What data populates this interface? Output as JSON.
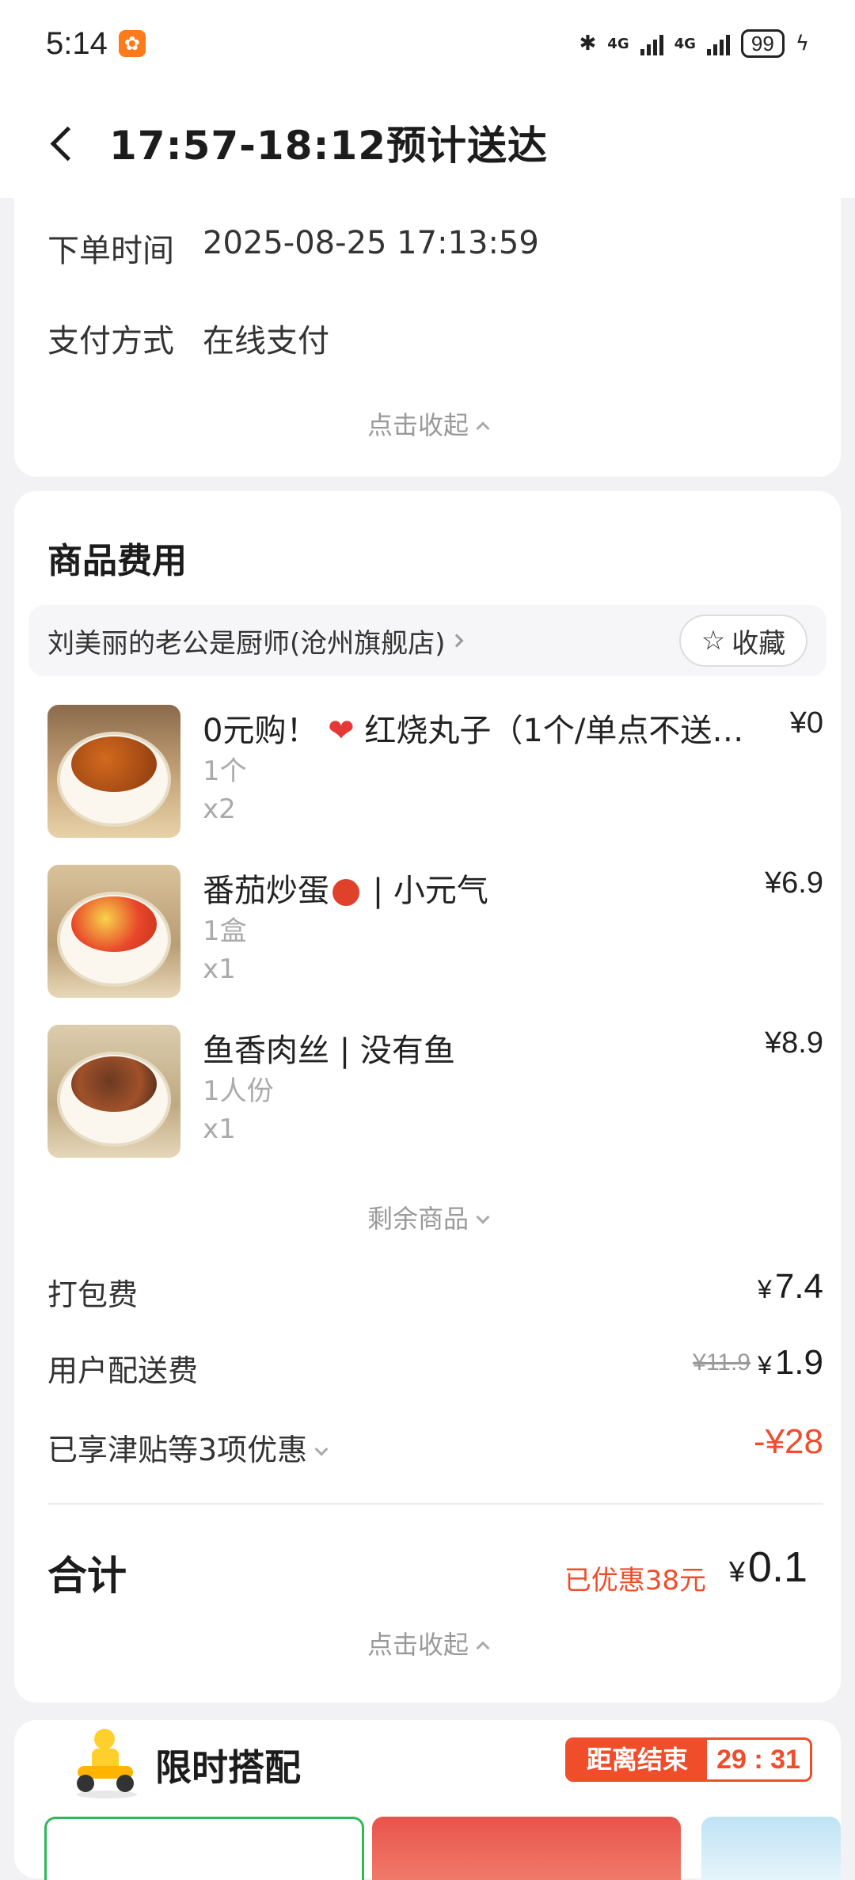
{
  "status_bar": {
    "time": "5:14",
    "network1": "4G",
    "network2": "4G",
    "battery": "99"
  },
  "header": {
    "title": "17:57-18:12预计送达"
  },
  "order_info": {
    "order_time_label": "下单时间",
    "order_time_value": "2025-08-25 17:13:59",
    "payment_label": "支付方式",
    "payment_value": "在线支付",
    "collapse_label": "点击收起"
  },
  "goods": {
    "section_title": "商品费用",
    "store_name": "刘美丽的老公是厨师(沧州旗舰店)",
    "favorite_label": "收藏",
    "items": [
      {
        "name_pre": "0元购！",
        "name_post": "红烧丸子（1个/单点不送…",
        "spec": "1个",
        "qty": "x2",
        "price": "¥0"
      },
      {
        "name_pre": "番茄炒蛋",
        "name_post": " | 小元气",
        "spec": "1盒",
        "qty": "x1",
        "price": "¥6.9"
      },
      {
        "name_pre": "鱼香肉丝 | 没有鱼",
        "name_post": "",
        "spec": "1人份",
        "qty": "x1",
        "price": "¥8.9"
      }
    ],
    "more_items_label": "剩余商品",
    "packing_fee_label": "打包费",
    "packing_fee": "7.4",
    "delivery_fee_label": "用户配送费",
    "delivery_fee_original": "¥11.9",
    "delivery_fee": "1.9",
    "discount_label": "已享津贴等3项优惠",
    "discount_amount": "-¥28",
    "total_label": "合计",
    "saved_label": "已优惠38元",
    "total_amount": "0.1",
    "collapse_label": "点击收起",
    "currency": "¥"
  },
  "promo": {
    "title": "限时搭配",
    "countdown_label": "距离结束",
    "countdown": "29 : 31"
  },
  "colors": {
    "accent_red": "#f04d2b",
    "page_bg": "#f2f2f4"
  }
}
